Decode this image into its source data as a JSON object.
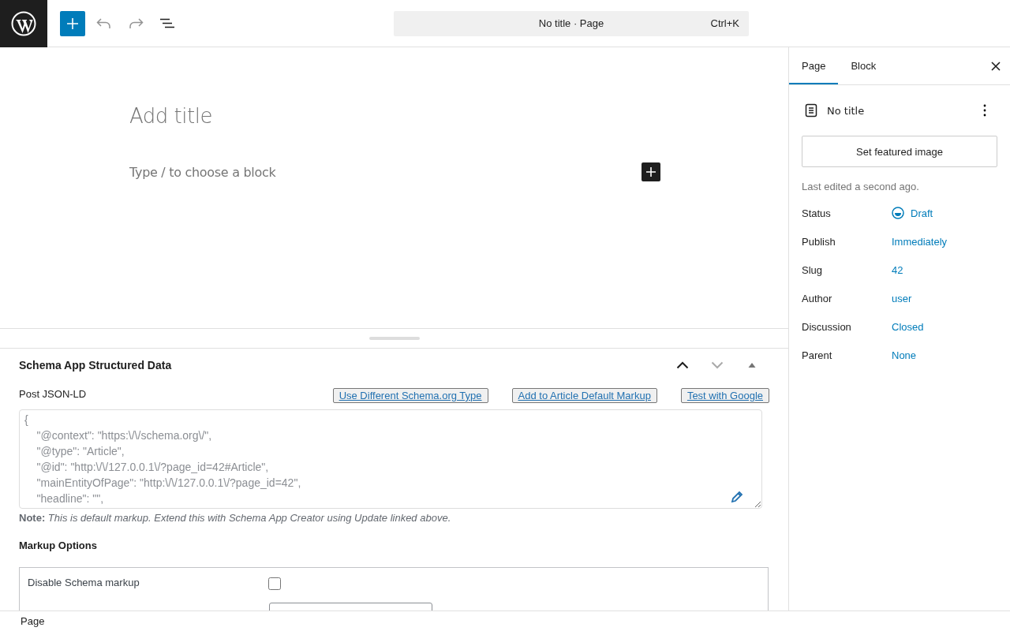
{
  "toolbar": {
    "command_bar": {
      "title": "No title · Page",
      "shortcut": "Ctrl+K"
    }
  },
  "editor": {
    "title_placeholder": "Add title",
    "block_placeholder": "Type / to choose a block"
  },
  "metabox": {
    "title": "Schema App Structured Data",
    "label": "Post JSON-LD",
    "actions": [
      "Use Different Schema.org Type",
      "Add to Article Default Markup",
      "Test with Google"
    ],
    "json_lines": [
      "{",
      "    \"@context\": \"https:\\/\\/schema.org\\/\",",
      "    \"@type\": \"Article\",",
      "    \"@id\": \"http:\\/\\/127.0.0.1\\/?page_id=42#Article\",",
      "    \"mainEntityOfPage\": \"http:\\/\\/127.0.0.1\\/?page_id=42\",",
      "    \"headline\": \"\","
    ],
    "note": "**Note:** *This is default markup. Extend this with Schema App Creator using Update linked above.*",
    "options_title": "Markup Options",
    "options": [
      {
        "label": "Disable Schema markup",
        "checked": false
      }
    ]
  },
  "sidebar": {
    "tabs": [
      {
        "label": "Page",
        "selected": true
      },
      {
        "label": "Block",
        "selected": false
      }
    ],
    "doc_title": "No title",
    "featured_button": "Set featured image",
    "last_edited": "Last edited a second ago.",
    "fields": [
      {
        "label": "Status",
        "value": "Draft",
        "kind": "status"
      },
      {
        "label": "Publish",
        "value": "Immediately",
        "kind": "link"
      },
      {
        "label": "Slug",
        "value": "42",
        "kind": "link"
      },
      {
        "label": "Author",
        "value": "user",
        "kind": "link"
      },
      {
        "label": "Discussion",
        "value": "Closed",
        "kind": "link"
      },
      {
        "label": "Parent",
        "value": "None",
        "kind": "link"
      }
    ]
  },
  "footer": {
    "breadcrumb": "Page"
  }
}
